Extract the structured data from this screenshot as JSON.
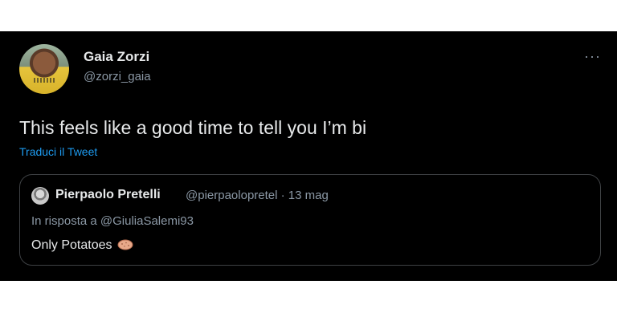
{
  "tweet": {
    "author_name": "Gaia Zorzi",
    "author_handle": "@zorzi_gaia",
    "more_label": "···",
    "text": "This feels like a good time to tell you I’m bi",
    "translate_label": "Traduci il Tweet"
  },
  "quote": {
    "author_name": "Pierpaolo Pretelli",
    "meta": "@pierpaolopretel · 13 mag",
    "reply_to": "In risposta a @GiuliaSalemi93",
    "text": "Only Potatoes",
    "emoji_icon": "potato-icon"
  }
}
